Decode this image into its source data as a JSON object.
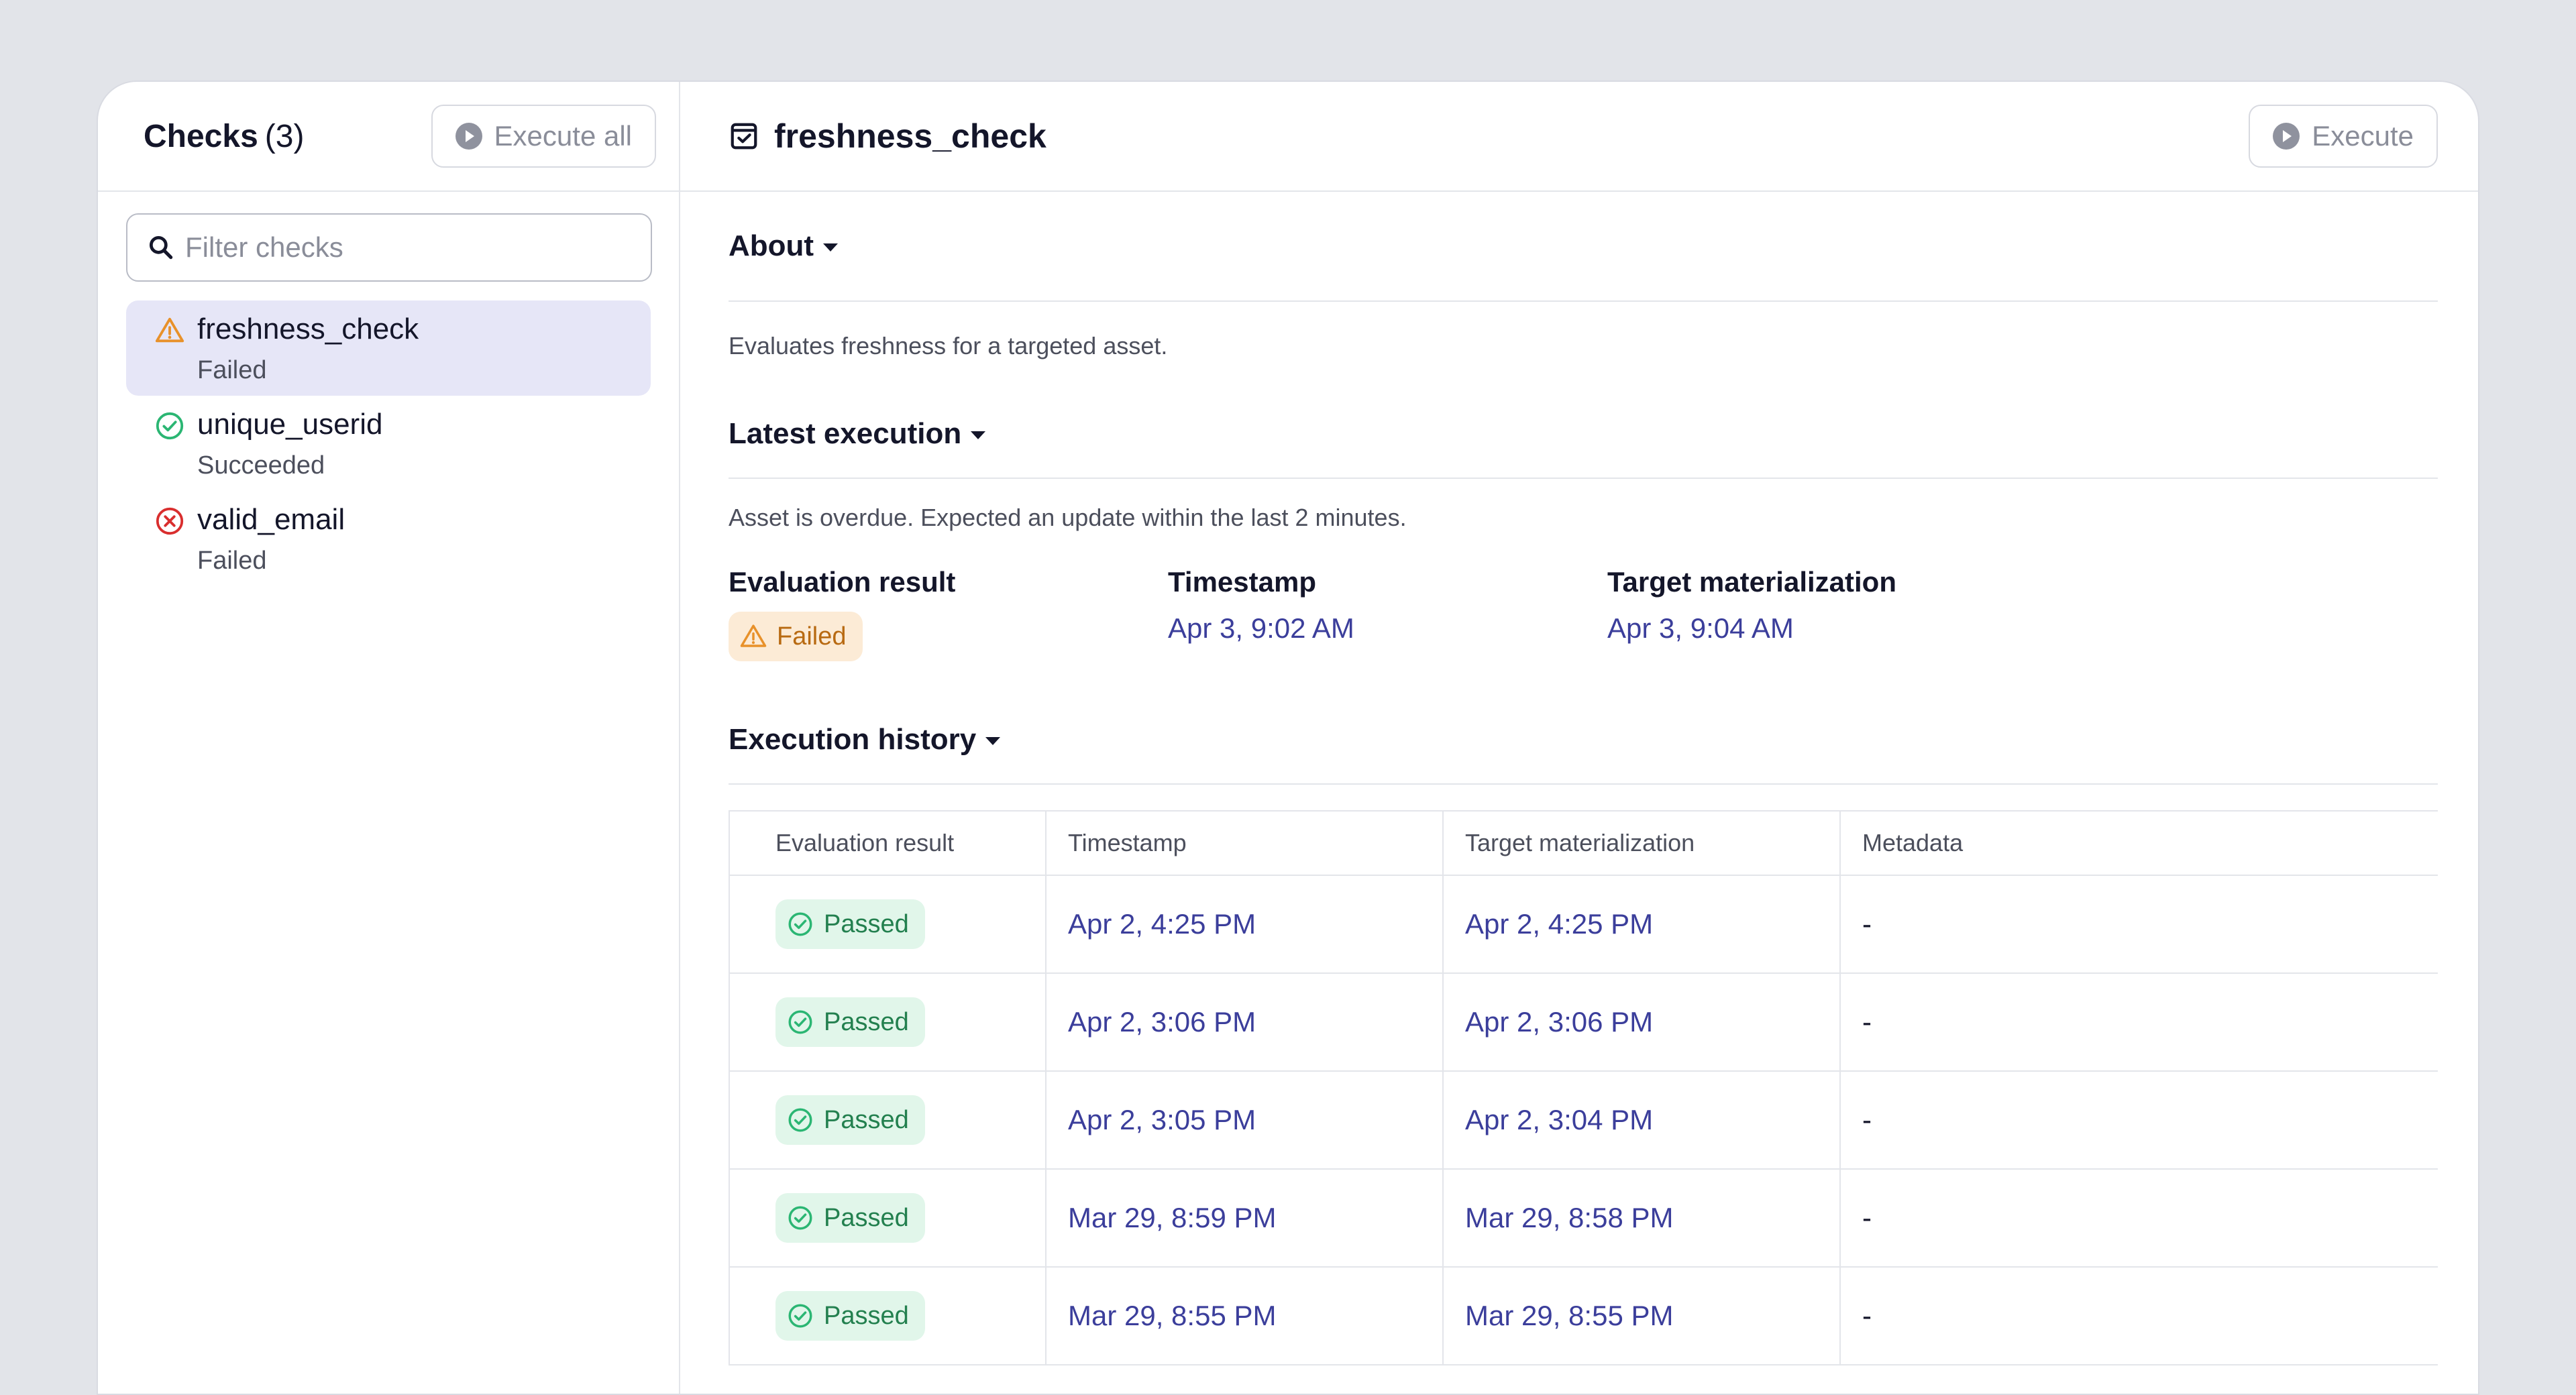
{
  "colors": {
    "accent": "#3b3e9b",
    "selected_bg": "#e6e6f7",
    "failed": "#e8912a",
    "passed": "#2bb673",
    "error": "#d92e2e"
  },
  "sidebar": {
    "title": "Checks",
    "count": "(3)",
    "execute_all_label": "Execute all",
    "search_placeholder": "Filter checks",
    "items": [
      {
        "name": "freshness_check",
        "status": "Failed",
        "icon": "warning-icon",
        "selected": true
      },
      {
        "name": "unique_userid",
        "status": "Succeeded",
        "icon": "check-circle-icon",
        "selected": false
      },
      {
        "name": "valid_email",
        "status": "Failed",
        "icon": "error-circle-icon",
        "selected": false
      }
    ]
  },
  "main": {
    "title": "freshness_check",
    "title_icon": "check-square-icon",
    "execute_label": "Execute",
    "about": {
      "heading": "About",
      "description": "Evaluates freshness for a targeted asset."
    },
    "latest": {
      "heading": "Latest execution",
      "description": "Asset is overdue. Expected an update within the last 2 minutes.",
      "eval_label": "Evaluation result",
      "eval_value": "Failed",
      "timestamp_label": "Timestamp",
      "timestamp_value": "Apr 3, 9:02 AM",
      "target_label": "Target materialization",
      "target_value": "Apr 3, 9:04 AM"
    },
    "history": {
      "heading": "Execution history",
      "columns": [
        "Evaluation result",
        "Timestamp",
        "Target materialization",
        "Metadata"
      ],
      "rows": [
        {
          "result": "Passed",
          "timestamp": "Apr 2, 4:25 PM",
          "target": "Apr 2, 4:25 PM",
          "metadata": "-"
        },
        {
          "result": "Passed",
          "timestamp": "Apr 2, 3:06 PM",
          "target": "Apr 2, 3:06 PM",
          "metadata": "-"
        },
        {
          "result": "Passed",
          "timestamp": "Apr 2, 3:05 PM",
          "target": "Apr 2, 3:04 PM",
          "metadata": "-"
        },
        {
          "result": "Passed",
          "timestamp": "Mar 29, 8:59 PM",
          "target": "Mar 29, 8:58 PM",
          "metadata": "-"
        },
        {
          "result": "Passed",
          "timestamp": "Mar 29, 8:55 PM",
          "target": "Mar 29, 8:55 PM",
          "metadata": "-"
        }
      ]
    }
  }
}
